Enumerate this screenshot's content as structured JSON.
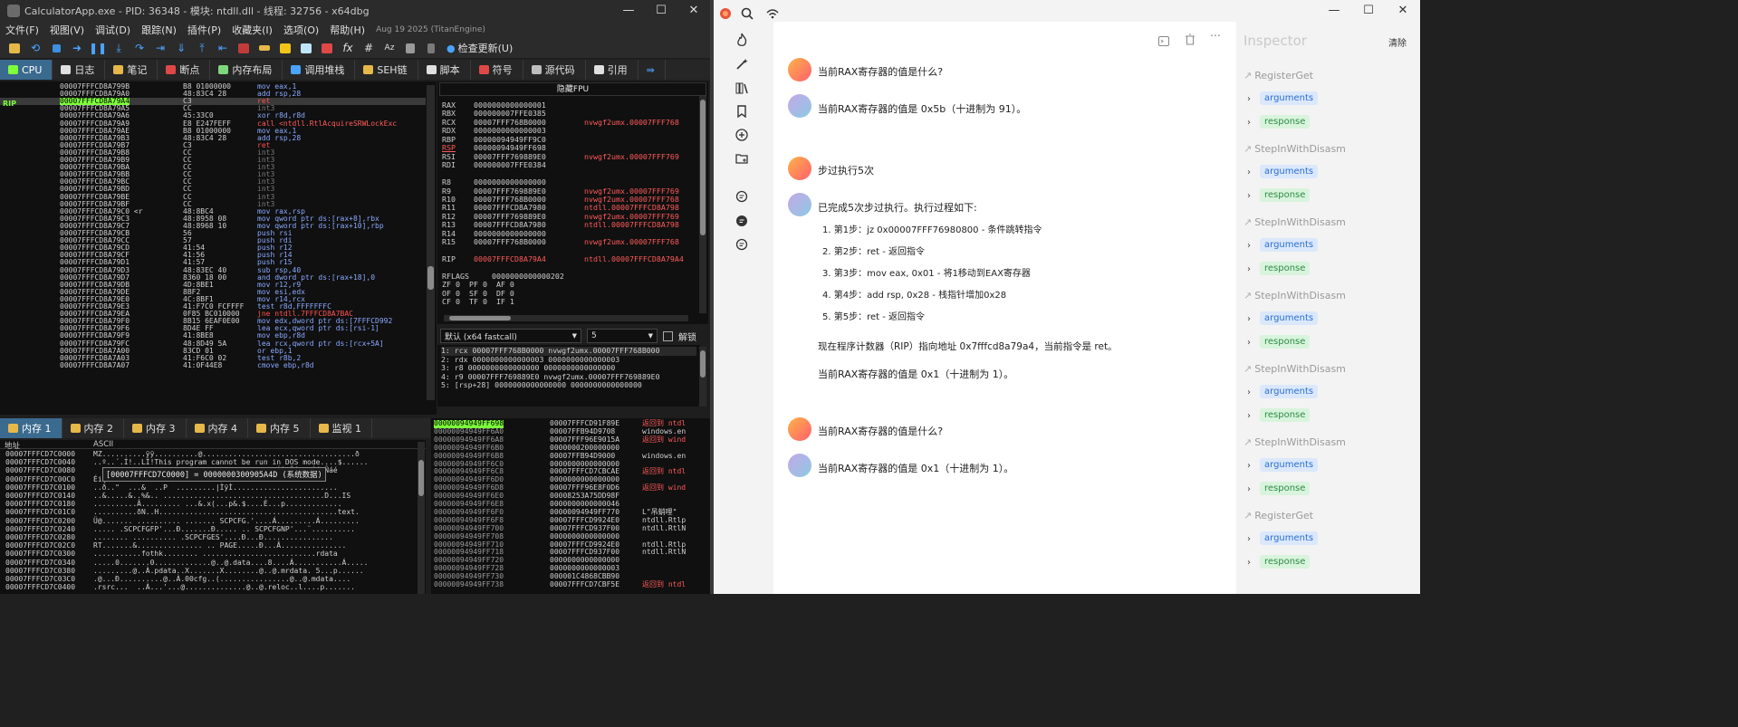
{
  "debugger": {
    "title": "CalculatorApp.exe - PID: 36348 - 模块: ntdll.dll - 线程: 32756 - x64dbg",
    "window_controls": [
      "—",
      "☐",
      "✕"
    ],
    "menu": [
      "文件(F)",
      "视图(V)",
      "调试(D)",
      "跟踪(N)",
      "插件(P)",
      "收藏夹(I)",
      "选项(O)",
      "帮助(H)"
    ],
    "menu_note": "Aug 19 2025 (TitanEngine)",
    "toolbar_fx": "fx",
    "toolbar_hash": "#",
    "toolbar_az": "Az",
    "toolbar_update": "检查更新(U)",
    "top_tabs": [
      "CPU",
      "日志",
      "笔记",
      "断点",
      "内存布局",
      "调用堆栈",
      "SEH链",
      "脚本",
      "符号",
      "源代码",
      "引用"
    ],
    "bottom_tabs": [
      "内存 1",
      "内存 2",
      "内存 3",
      "内存 4",
      "内存 5",
      "监视 1"
    ],
    "rip_label": "RIP",
    "disasm": [
      [
        "00007FFFCD8A799B",
        "B8 01000000",
        "mov eax,1",
        ""
      ],
      [
        "00007FFFCD8A79A0",
        "48:83C4 28",
        "add rsp,28",
        ""
      ],
      [
        "00007FFFCD8A79A4",
        "C3",
        "ret",
        "cur"
      ],
      [
        "00007FFFCD8A79A5",
        "CC",
        "int3",
        "int3"
      ],
      [
        "00007FFFCD8A79A6",
        "45:33C0",
        "xor r8d,r8d",
        ""
      ],
      [
        "00007FFFCD8A79A9",
        "E8 E247FEFF",
        "call <ntdll.RtlAcquireSRWLockExc",
        "call"
      ],
      [
        "00007FFFCD8A79AE",
        "B8 01000000",
        "mov eax,1",
        ""
      ],
      [
        "00007FFFCD8A79B3",
        "48:83C4 28",
        "add rsp,28",
        ""
      ],
      [
        "00007FFFCD8A79B7",
        "C3",
        "ret",
        "retc"
      ],
      [
        "00007FFFCD8A79B8",
        "CC",
        "int3",
        "int3"
      ],
      [
        "00007FFFCD8A79B9",
        "CC",
        "int3",
        "int3"
      ],
      [
        "00007FFFCD8A79BA",
        "CC",
        "int3",
        "int3"
      ],
      [
        "00007FFFCD8A79BB",
        "CC",
        "int3",
        "int3"
      ],
      [
        "00007FFFCD8A79BC",
        "CC",
        "int3",
        "int3"
      ],
      [
        "00007FFFCD8A79BD",
        "CC",
        "int3",
        "int3"
      ],
      [
        "00007FFFCD8A79BE",
        "CC",
        "int3",
        "int3"
      ],
      [
        "00007FFFCD8A79BF",
        "CC",
        "int3",
        "int3"
      ],
      [
        "00007FFFCD8A79C0 <r",
        "48:8BC4",
        "mov rax,rsp",
        ""
      ],
      [
        "00007FFFCD8A79C3",
        "48:8958 08",
        "mov qword ptr ds:[rax+8],rbx",
        ""
      ],
      [
        "00007FFFCD8A79C7",
        "48:8968 10",
        "mov qword ptr ds:[rax+10],rbp",
        ""
      ],
      [
        "00007FFFCD8A79CB",
        "56",
        "push rsi",
        ""
      ],
      [
        "00007FFFCD8A79CC",
        "57",
        "push rdi",
        ""
      ],
      [
        "00007FFFCD8A79CD",
        "41:54",
        "push r12",
        ""
      ],
      [
        "00007FFFCD8A79CF",
        "41:56",
        "push r14",
        ""
      ],
      [
        "00007FFFCD8A79D1",
        "41:57",
        "push r15",
        ""
      ],
      [
        "00007FFFCD8A79D3",
        "48:83EC 40",
        "sub rsp,40",
        ""
      ],
      [
        "00007FFFCD8A79D7",
        "8360 18 00",
        "and dword ptr ds:[rax+18],0",
        ""
      ],
      [
        "00007FFFCD8A79DB",
        "4D:8BE1",
        "mov r12,r9",
        ""
      ],
      [
        "00007FFFCD8A79DE",
        "8BF2",
        "mov esi,edx",
        ""
      ],
      [
        "00007FFFCD8A79E0",
        "4C:8BF1",
        "mov r14,rcx",
        ""
      ],
      [
        "00007FFFCD8A79E3",
        "41:F7C0 FCFFFF",
        "test r8d,FFFFFFFC",
        ""
      ],
      [
        "00007FFFCD8A79EA",
        "0F85 BC010000",
        "jne ntdll.7FFFCD8A7BAC",
        "jcc"
      ],
      [
        "00007FFFCD8A79F0",
        "8B15 6EAF0E00",
        "mov edx,dword ptr ds:[7FFFCD992",
        ""
      ],
      [
        "00007FFFCD8A79F6",
        "8D4E FF",
        "lea ecx,qword ptr ds:[rsi-1]",
        ""
      ],
      [
        "00007FFFCD8A79F9",
        "41:8BE8",
        "mov ebp,r8d",
        ""
      ],
      [
        "00007FFFCD8A79FC",
        "48:8D49 5A",
        "lea rcx,qword ptr ds:[rcx+5A]",
        ""
      ],
      [
        "00007FFFCD8A7A00",
        "83CD 01",
        "or ebp,1",
        ""
      ],
      [
        "00007FFFCD8A7A03",
        "41:F6C0 02",
        "test r8b,2",
        ""
      ],
      [
        "00007FFFCD8A7A07",
        "41:0F44E8",
        "cmove ebp,r8d",
        ""
      ]
    ],
    "fpu_header": "隐藏FPU",
    "registers": [
      [
        "RAX",
        "0000000000000001",
        "",
        ""
      ],
      [
        "RBX",
        "000000007FFE0385",
        "",
        ""
      ],
      [
        "RCX",
        "00007FFF768B0000",
        "nvwgf2umx.00007FFF768",
        ""
      ],
      [
        "RDX",
        "0000000000000003",
        "",
        ""
      ],
      [
        "RBP",
        "00000094949FF9C0",
        "",
        ""
      ],
      [
        "RSP",
        "00000094949FF698",
        "",
        "ul"
      ],
      [
        "RSI",
        "00007FFF769889E0",
        "nvwgf2umx.00007FFF769",
        ""
      ],
      [
        "RDI",
        "000000007FFE0384",
        "",
        ""
      ],
      [
        "",
        "",
        "",
        ""
      ],
      [
        "R8",
        "0000000000000000",
        "",
        ""
      ],
      [
        "R9",
        "00007FFF769889E0",
        "nvwgf2umx.00007FFF769",
        ""
      ],
      [
        "R10",
        "00007FFF768B0000",
        "nvwgf2umx.00007FFF768",
        ""
      ],
      [
        "R11",
        "00007FFFCD8A7980",
        "ntdll.00007FFFCD8A798",
        ""
      ],
      [
        "R12",
        "00007FFF769889E0",
        "nvwgf2umx.00007FFF769",
        ""
      ],
      [
        "R13",
        "00007FFFCD8A7980",
        "ntdll.00007FFFCD8A798",
        ""
      ],
      [
        "R14",
        "0000000000000000",
        "",
        ""
      ],
      [
        "R15",
        "00007FFF768B0000",
        "nvwgf2umx.00007FFF768",
        ""
      ],
      [
        "",
        "",
        "",
        ""
      ],
      [
        "RIP",
        "00007FFFCD8A79A4",
        "ntdll.00007FFFCD8A79A4",
        "rip"
      ],
      [
        "",
        "",
        "",
        ""
      ],
      [
        "RFLAGS",
        "    0000000000000202",
        "",
        ""
      ],
      [
        "ZF 0  PF 0  AF 0",
        "",
        "",
        ""
      ],
      [
        "OF 0  SF 0  DF 0",
        "",
        "",
        ""
      ],
      [
        "CF 0  TF 0  IF 1",
        "",
        "",
        ""
      ]
    ],
    "call_conv": "默认 (x64 fastcall)",
    "arg_count": "5",
    "unlock_label": "解锁",
    "stack_args": [
      "1: rcx 00007FFF768B0000 nvwgf2umx.00007FFF768B000",
      "2: rdx 0000000000000003 0000000000000003",
      "3: r8 0000000000000000 0000000000000000",
      "4: r9 00007FFF769889E0 nvwgf2umx.00007FFF769889E0",
      "5: [rsp+28] 0000000000000000 0000000000000000"
    ],
    "dump_header_addr": "地址",
    "dump_header_ascii": "ASCII",
    "dump": [
      [
        "00007FFFCD7C0000",
        "MZ..........ÿÿ..........@...................................ð"
      ],
      [
        "00007FFFCD7C0040",
        "..º..´.Í!..LÍ!This program cannot be run in DOS mode....$......"
      ],
      [
        "00007FFFCD7C0080",
        "                                      .ebDÉîfÑíebDÉíjÑáé"
      ],
      [
        "00007FFFCD7C00C0",
        "Éiç¬ÉcÉd.Éb Úb.Écde.ÉcÉ.hÉ.ÛÉ......PE..d...P.L#..."
      ],
      [
        "00007FFFCD7C0100",
        "..ð..\"  ...&  ..P  .........|ÌÿÌ........................"
      ],
      [
        "00007FFFCD7C0140",
        "..&.....&..%&.. .....................................D...IS"
      ],
      [
        "00007FFFCD7C0180",
        "..........Â......... ...&.x(...p&.$....È...p............."
      ],
      [
        "00007FFFCD7C01C0",
        "..........ðN..H.........................................text."
      ],
      [
        "00007FFFCD7C0200",
        "Ü@....... .......... ....... SCPCFG.'....Á.........Á........."
      ],
      [
        "00007FFFCD7C0240",
        "..... .SCPCFGFP'...Ð.......Ð..... .. SCPCFGNP'...¨.........."
      ],
      [
        "00007FFFCD7C0280",
        "........ .......... .SCPCFGES'....Ð...Ð................"
      ],
      [
        "00007FFFCD7C02C0",
        "RT.......&............... .. PAGE.....Ð...Â..............."
      ],
      [
        "00007FFFCD7C0300",
        "...........fothk........ ..........................rdata"
      ],
      [
        "00007FFFCD7C0340",
        ".....0.......0.............@..@.data....8....Á...........Á....."
      ],
      [
        "00007FFFCD7C0380",
        ".........@..À.pdata..X.......X........@..@.mrdata. 5...p......"
      ],
      [
        "00007FFFCD7C03C0",
        ".@...Ð..........@..À.00cfg..(................@..@.mdata...."
      ],
      [
        "00007FFFCD7C0400",
        ".rsrc...  ..À...'...@..............@..@.reloc..l....p......."
      ]
    ],
    "dump_tooltip": "[00007FFFCD7C0000] = 0000000300905A4D (系统数据)",
    "stack": [
      [
        "00000094949FF698",
        "00007FFFCD91F89E",
        "返回到 ntdl",
        "red"
      ],
      [
        "00000094949FF6A0",
        "00007FFB94D9708",
        "windows.en",
        ""
      ],
      [
        "00000094949FF6A8",
        "00007FFF96E9015A",
        "返回到 wind",
        "red"
      ],
      [
        "00000094949FF6B0",
        "0000000200000000",
        "",
        ""
      ],
      [
        "00000094949FF6B8",
        "00007FFB94D9000",
        "windows.en",
        ""
      ],
      [
        "00000094949FF6C0",
        "0000000000000000",
        "",
        ""
      ],
      [
        "00000094949FF6C8",
        "00007FFFCD7CBCAE",
        "返回到 ntdl",
        "red"
      ],
      [
        "00000094949FF6D0",
        "0000000000000000",
        "",
        ""
      ],
      [
        "00000094949FF6D8",
        "00007FFF96E8F0D6",
        "返回到 wind",
        "red"
      ],
      [
        "00000094949FF6E0",
        "00008253A75DD98F",
        "",
        ""
      ],
      [
        "00000094949FF6E8",
        "0000000000000046",
        "",
        ""
      ],
      [
        "00000094949FF6F0",
        "00000094949FF770",
        "L\"吊蛸哩\"",
        ""
      ],
      [
        "00000094949FF6F8",
        "00007FFFCD9924E0",
        "ntdll.Rtlp",
        ""
      ],
      [
        "00000094949FF700",
        "00007FFFCD937F00",
        "ntdll.RtlN",
        ""
      ],
      [
        "00000094949FF708",
        "0000000000000000",
        "",
        ""
      ],
      [
        "00000094949FF710",
        "00007FFFCD9924E0",
        "ntdll.Rtlp",
        ""
      ],
      [
        "00000094949FF718",
        "00007FFFCD937F00",
        "ntdll.RtlN",
        ""
      ],
      [
        "00000094949FF720",
        "0000000000000000",
        "",
        ""
      ],
      [
        "00000094949FF728",
        "0000000000000003",
        "",
        ""
      ],
      [
        "00000094949FF730",
        "000001C4868CBB90",
        "",
        ""
      ],
      [
        "00000094949FF738",
        "00007FFFCD7CBF5E",
        "返回到 ntdl",
        "red"
      ]
    ]
  },
  "chat": {
    "window_controls": [
      "—",
      "☐",
      "✕"
    ],
    "messages": [
      {
        "role": "user",
        "text": "当前RAX寄存器的值是什么?"
      },
      {
        "role": "assistant",
        "text": "当前RAX寄存器的值是 0x5b（十进制为 91）。"
      },
      {
        "role": "user",
        "text": "步过执行5次"
      },
      {
        "role": "assistant",
        "text": "已完成5次步过执行。执行过程如下:"
      },
      {
        "role": "user",
        "text": "当前RAX寄存器的值是什么?"
      },
      {
        "role": "assistant",
        "text": "当前RAX寄存器的值是 0x1（十进制为 1）。"
      }
    ],
    "steps": [
      "1. 第1步：jz 0x00007FFF76980800 - 条件跳转指令",
      "2. 第2步：ret - 返回指令",
      "3. 第3步：mov eax, 0x01 - 将1移动到EAX寄存器",
      "4. 第4步：add rsp, 0x28 - 栈指针增加0x28",
      "5. 第5步：ret - 返回指令"
    ],
    "summary_pc": "现在程序计数器（RIP）指向地址 0x7fffcd8a79a4，当前指令是 ret。",
    "summary_rax": "当前RAX寄存器的值是 0x1（十进制为 1）。"
  },
  "inspector": {
    "title": "Inspector",
    "clear_label": "清除",
    "arguments_label": "arguments",
    "response_label": "response",
    "calls": [
      "RegisterGet",
      "StepInWithDisasm",
      "StepInWithDisasm",
      "StepInWithDisasm",
      "StepInWithDisasm",
      "StepInWithDisasm",
      "RegisterGet"
    ]
  }
}
